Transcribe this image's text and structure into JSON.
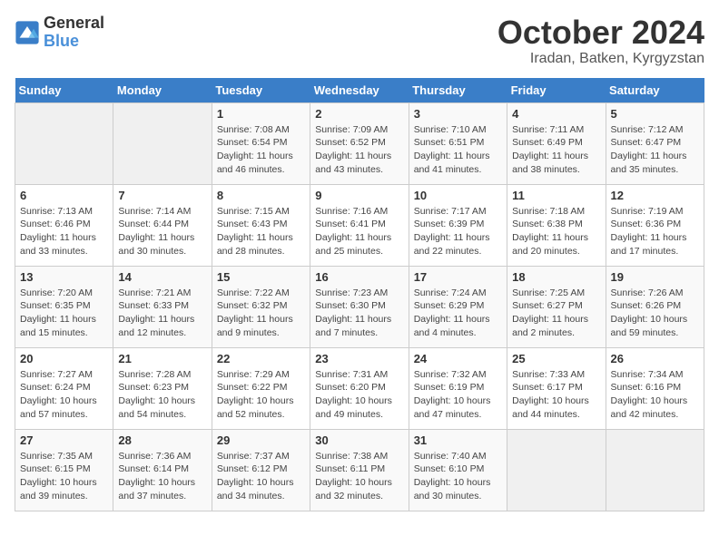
{
  "header": {
    "logo_line1": "General",
    "logo_line2": "Blue",
    "month_title": "October 2024",
    "location": "Iradan, Batken, Kyrgyzstan"
  },
  "days_of_week": [
    "Sunday",
    "Monday",
    "Tuesday",
    "Wednesday",
    "Thursday",
    "Friday",
    "Saturday"
  ],
  "weeks": [
    [
      {
        "day": "",
        "sunrise": "",
        "sunset": "",
        "daylight": ""
      },
      {
        "day": "",
        "sunrise": "",
        "sunset": "",
        "daylight": ""
      },
      {
        "day": "1",
        "sunrise": "Sunrise: 7:08 AM",
        "sunset": "Sunset: 6:54 PM",
        "daylight": "Daylight: 11 hours and 46 minutes."
      },
      {
        "day": "2",
        "sunrise": "Sunrise: 7:09 AM",
        "sunset": "Sunset: 6:52 PM",
        "daylight": "Daylight: 11 hours and 43 minutes."
      },
      {
        "day": "3",
        "sunrise": "Sunrise: 7:10 AM",
        "sunset": "Sunset: 6:51 PM",
        "daylight": "Daylight: 11 hours and 41 minutes."
      },
      {
        "day": "4",
        "sunrise": "Sunrise: 7:11 AM",
        "sunset": "Sunset: 6:49 PM",
        "daylight": "Daylight: 11 hours and 38 minutes."
      },
      {
        "day": "5",
        "sunrise": "Sunrise: 7:12 AM",
        "sunset": "Sunset: 6:47 PM",
        "daylight": "Daylight: 11 hours and 35 minutes."
      }
    ],
    [
      {
        "day": "6",
        "sunrise": "Sunrise: 7:13 AM",
        "sunset": "Sunset: 6:46 PM",
        "daylight": "Daylight: 11 hours and 33 minutes."
      },
      {
        "day": "7",
        "sunrise": "Sunrise: 7:14 AM",
        "sunset": "Sunset: 6:44 PM",
        "daylight": "Daylight: 11 hours and 30 minutes."
      },
      {
        "day": "8",
        "sunrise": "Sunrise: 7:15 AM",
        "sunset": "Sunset: 6:43 PM",
        "daylight": "Daylight: 11 hours and 28 minutes."
      },
      {
        "day": "9",
        "sunrise": "Sunrise: 7:16 AM",
        "sunset": "Sunset: 6:41 PM",
        "daylight": "Daylight: 11 hours and 25 minutes."
      },
      {
        "day": "10",
        "sunrise": "Sunrise: 7:17 AM",
        "sunset": "Sunset: 6:39 PM",
        "daylight": "Daylight: 11 hours and 22 minutes."
      },
      {
        "day": "11",
        "sunrise": "Sunrise: 7:18 AM",
        "sunset": "Sunset: 6:38 PM",
        "daylight": "Daylight: 11 hours and 20 minutes."
      },
      {
        "day": "12",
        "sunrise": "Sunrise: 7:19 AM",
        "sunset": "Sunset: 6:36 PM",
        "daylight": "Daylight: 11 hours and 17 minutes."
      }
    ],
    [
      {
        "day": "13",
        "sunrise": "Sunrise: 7:20 AM",
        "sunset": "Sunset: 6:35 PM",
        "daylight": "Daylight: 11 hours and 15 minutes."
      },
      {
        "day": "14",
        "sunrise": "Sunrise: 7:21 AM",
        "sunset": "Sunset: 6:33 PM",
        "daylight": "Daylight: 11 hours and 12 minutes."
      },
      {
        "day": "15",
        "sunrise": "Sunrise: 7:22 AM",
        "sunset": "Sunset: 6:32 PM",
        "daylight": "Daylight: 11 hours and 9 minutes."
      },
      {
        "day": "16",
        "sunrise": "Sunrise: 7:23 AM",
        "sunset": "Sunset: 6:30 PM",
        "daylight": "Daylight: 11 hours and 7 minutes."
      },
      {
        "day": "17",
        "sunrise": "Sunrise: 7:24 AM",
        "sunset": "Sunset: 6:29 PM",
        "daylight": "Daylight: 11 hours and 4 minutes."
      },
      {
        "day": "18",
        "sunrise": "Sunrise: 7:25 AM",
        "sunset": "Sunset: 6:27 PM",
        "daylight": "Daylight: 11 hours and 2 minutes."
      },
      {
        "day": "19",
        "sunrise": "Sunrise: 7:26 AM",
        "sunset": "Sunset: 6:26 PM",
        "daylight": "Daylight: 10 hours and 59 minutes."
      }
    ],
    [
      {
        "day": "20",
        "sunrise": "Sunrise: 7:27 AM",
        "sunset": "Sunset: 6:24 PM",
        "daylight": "Daylight: 10 hours and 57 minutes."
      },
      {
        "day": "21",
        "sunrise": "Sunrise: 7:28 AM",
        "sunset": "Sunset: 6:23 PM",
        "daylight": "Daylight: 10 hours and 54 minutes."
      },
      {
        "day": "22",
        "sunrise": "Sunrise: 7:29 AM",
        "sunset": "Sunset: 6:22 PM",
        "daylight": "Daylight: 10 hours and 52 minutes."
      },
      {
        "day": "23",
        "sunrise": "Sunrise: 7:31 AM",
        "sunset": "Sunset: 6:20 PM",
        "daylight": "Daylight: 10 hours and 49 minutes."
      },
      {
        "day": "24",
        "sunrise": "Sunrise: 7:32 AM",
        "sunset": "Sunset: 6:19 PM",
        "daylight": "Daylight: 10 hours and 47 minutes."
      },
      {
        "day": "25",
        "sunrise": "Sunrise: 7:33 AM",
        "sunset": "Sunset: 6:17 PM",
        "daylight": "Daylight: 10 hours and 44 minutes."
      },
      {
        "day": "26",
        "sunrise": "Sunrise: 7:34 AM",
        "sunset": "Sunset: 6:16 PM",
        "daylight": "Daylight: 10 hours and 42 minutes."
      }
    ],
    [
      {
        "day": "27",
        "sunrise": "Sunrise: 7:35 AM",
        "sunset": "Sunset: 6:15 PM",
        "daylight": "Daylight: 10 hours and 39 minutes."
      },
      {
        "day": "28",
        "sunrise": "Sunrise: 7:36 AM",
        "sunset": "Sunset: 6:14 PM",
        "daylight": "Daylight: 10 hours and 37 minutes."
      },
      {
        "day": "29",
        "sunrise": "Sunrise: 7:37 AM",
        "sunset": "Sunset: 6:12 PM",
        "daylight": "Daylight: 10 hours and 34 minutes."
      },
      {
        "day": "30",
        "sunrise": "Sunrise: 7:38 AM",
        "sunset": "Sunset: 6:11 PM",
        "daylight": "Daylight: 10 hours and 32 minutes."
      },
      {
        "day": "31",
        "sunrise": "Sunrise: 7:40 AM",
        "sunset": "Sunset: 6:10 PM",
        "daylight": "Daylight: 10 hours and 30 minutes."
      },
      {
        "day": "",
        "sunrise": "",
        "sunset": "",
        "daylight": ""
      },
      {
        "day": "",
        "sunrise": "",
        "sunset": "",
        "daylight": ""
      }
    ]
  ]
}
